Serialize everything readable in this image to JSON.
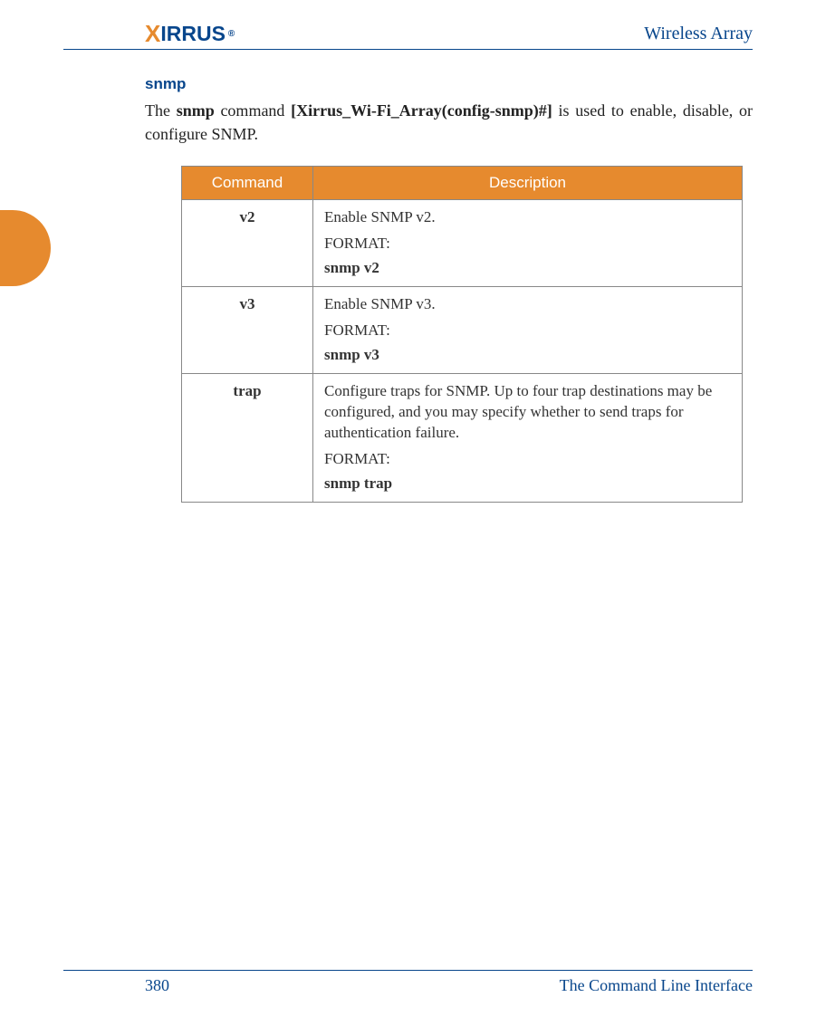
{
  "header": {
    "logo_text": "IRRUS",
    "doc_title": "Wireless Array"
  },
  "section": {
    "title": "snmp",
    "intro_prefix": "The ",
    "intro_bold1": "snmp",
    "intro_mid": " command ",
    "intro_bold2": "[Xirrus_Wi-Fi_Array(config-snmp)#]",
    "intro_suffix": " is used to enable, disable, or configure SNMP."
  },
  "table": {
    "headers": [
      "Command",
      "Description"
    ],
    "rows": [
      {
        "command": "v2",
        "desc": "Enable SNMP v2.",
        "format_label": "FORMAT:",
        "format_cmd": "snmp v2"
      },
      {
        "command": "v3",
        "desc": "Enable SNMP v3.",
        "format_label": "FORMAT:",
        "format_cmd": "snmp v3"
      },
      {
        "command": "trap",
        "desc": "Configure traps for SNMP. Up to four trap destinations may be configured, and you may specify whether to send traps for authentication failure.",
        "format_label": "FORMAT:",
        "format_cmd": "snmp trap"
      }
    ]
  },
  "footer": {
    "page_number": "380",
    "section_title": "The Command Line Interface"
  }
}
